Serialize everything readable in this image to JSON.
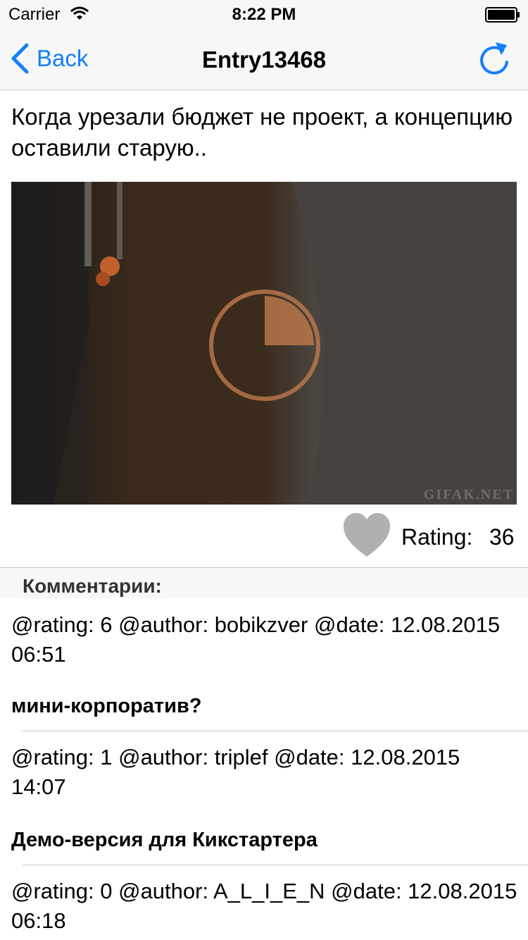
{
  "status_bar": {
    "carrier": "Carrier",
    "time": "8:22 PM"
  },
  "nav": {
    "back_label": "Back",
    "title": "Entry13468"
  },
  "entry": {
    "text": "Когда урезали бюджет не проект, а концепцию оставили старую..",
    "watermark": "GIFAK.NET",
    "loading_progress": 0.25
  },
  "rating": {
    "label": "Rating:",
    "value": "36"
  },
  "comments_header": "Комментарии:",
  "comments": [
    {
      "meta": "@rating: 6 @author: bobikzver @date: 12.08.2015 06:51",
      "text": "мини-корпоратив?"
    },
    {
      "meta": "@rating: 1 @author: triplef @date: 12.08.2015 14:07",
      "text": "Демо-версия для Кикстартера"
    },
    {
      "meta": "@rating: 0 @author: A_L_I_E_N @date: 12.08.2015 06:18",
      "text": ""
    }
  ],
  "colors": {
    "accent": "#147efb",
    "heart": "#b0b0b0",
    "loader": "#b8764a"
  },
  "icons": [
    "wifi-icon",
    "battery-icon",
    "chevron-left-icon",
    "refresh-icon",
    "loader-icon",
    "heart-icon"
  ]
}
